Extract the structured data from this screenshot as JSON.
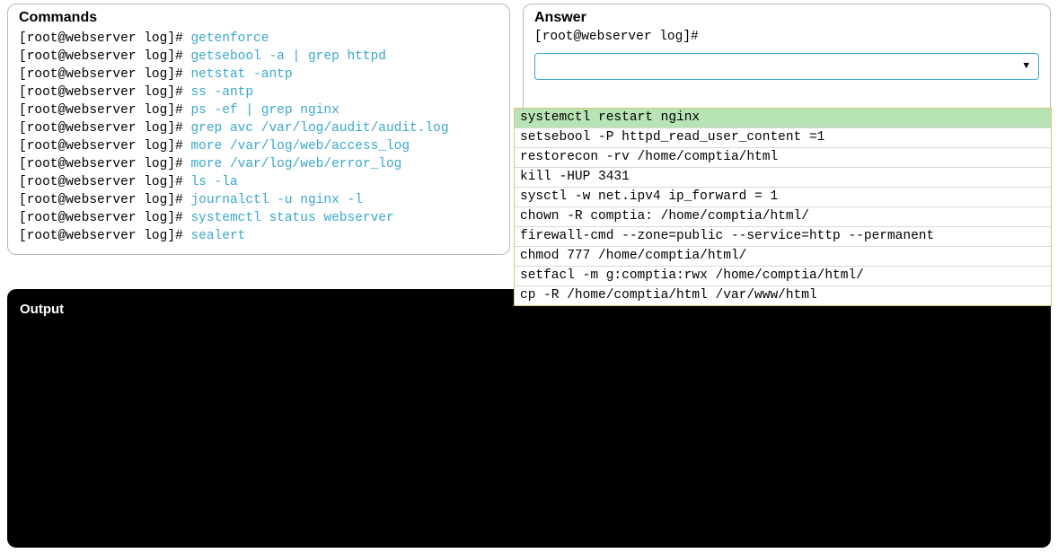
{
  "commands": {
    "title": "Commands",
    "prompt": "[root@webserver log]# ",
    "lines": [
      "getenforce",
      "getsebool -a | grep httpd",
      "netstat -antp",
      "ss -antp",
      "ps -ef | grep nginx",
      "grep avc /var/log/audit/audit.log",
      "more /var/log/web/access_log",
      "more /var/log/web/error_log",
      "ls -la",
      "journalctl -u nginx -l",
      "systemctl status webserver",
      "sealert"
    ]
  },
  "answer": {
    "title": "Answer",
    "prompt": "[root@webserver log]#",
    "options": [
      "systemctl restart nginx",
      "setsebool -P httpd_read_user_content =1",
      "restorecon -rv /home/comptia/html",
      "kill -HUP 3431",
      "sysctl -w net.ipv4 ip_forward = 1",
      "chown -R comptia: /home/comptia/html/",
      "firewall-cmd --zone=public --service=http --permanent",
      "chmod 777 /home/comptia/html/",
      "setfacl -m g:comptia:rwx /home/comptia/html/",
      "cp -R /home/comptia/html /var/www/html"
    ],
    "selected_index": 0
  },
  "output": {
    "title": "Output"
  }
}
